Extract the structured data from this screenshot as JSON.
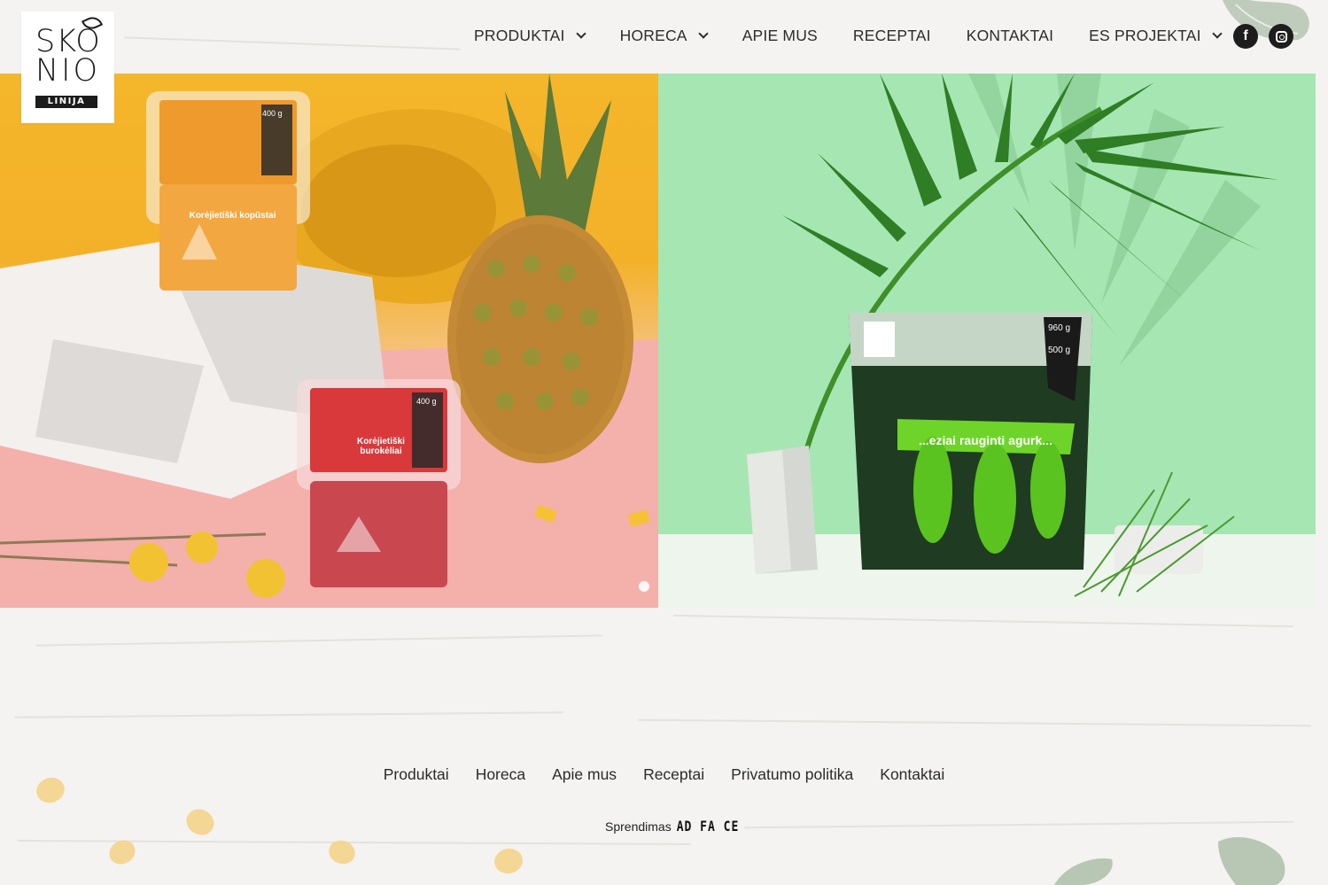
{
  "brand": {
    "logo_line1": "SKO",
    "logo_line2": "NIO",
    "logo_sub": "LINIJA"
  },
  "nav": {
    "items": [
      {
        "label": "PRODUKTAI",
        "dropdown": true
      },
      {
        "label": "HORECA",
        "dropdown": true
      },
      {
        "label": "APIE MUS",
        "dropdown": false
      },
      {
        "label": "RECEPTAI",
        "dropdown": false
      },
      {
        "label": "KONTAKTAI",
        "dropdown": false
      },
      {
        "label": "ES PROJEKTAI",
        "dropdown": true
      }
    ]
  },
  "social": {
    "facebook_icon": "facebook-icon",
    "instagram_icon": "instagram-icon"
  },
  "hero": {
    "left_panel": {
      "product_top_label": "Korėjietiški kopūstai",
      "product_top_weight": "400 g",
      "product_bottom_label": "Korėjietiški burokėliai",
      "product_bottom_weight": "400 g",
      "colors": {
        "background": "#f4b62a"
      }
    },
    "right_panel": {
      "bag_label": "...eziai rauginti agurk...",
      "weight_top": "960 g",
      "weight_bottom": "500 g",
      "colors": {
        "background": "#a6e6b3"
      }
    },
    "carousel": {
      "active_slide": 1
    }
  },
  "footer": {
    "links": [
      "Produktai",
      "Horeca",
      "Apie mus",
      "Receptai",
      "Privatumo politika",
      "Kontaktai"
    ],
    "credit_text": "Sprendimas",
    "credit_logo": "AD FA CE"
  }
}
